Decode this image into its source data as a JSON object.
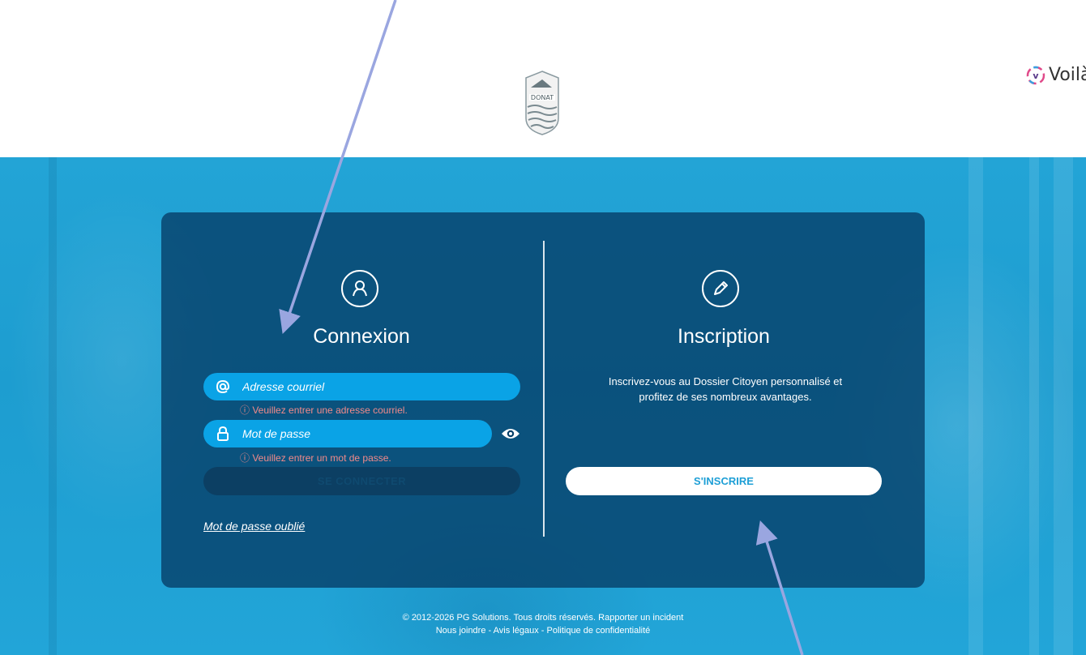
{
  "header": {
    "municipality_logo_alt": "St-Donat",
    "logo_text": "DONAT",
    "brand_name": "Voilà!"
  },
  "login": {
    "title": "Connexion",
    "email_placeholder": "Adresse courriel",
    "email_error": "ⓘ Veuillez entrer une adresse courriel.",
    "password_placeholder": "Mot de passe",
    "password_error": "ⓘ Veuillez entrer un mot de passe.",
    "submit_label": "SE CONNECTER",
    "forgot_label": "Mot de passe oublié"
  },
  "signup": {
    "title": "Inscription",
    "description": "Inscrivez-vous au Dossier Citoyen personnalisé et profitez de ses nombreux avantages.",
    "button_label": "S'INSCRIRE"
  },
  "footer": {
    "copyright": "© 2012-2026 PG Solutions. Tous droits réservés.",
    "report_incident": "Rapporter un incident",
    "contact": "Nous joindre",
    "legal": "Avis légaux",
    "privacy": "Politique de confidentialité",
    "separator": " - "
  },
  "colors": {
    "background": "#1d9dd0",
    "panel": "#063f68",
    "input": "#0aa3e6",
    "error": "#f28a8a",
    "arrow": "#9aa6e0"
  },
  "icons": [
    "user-icon",
    "pencil-icon",
    "at-icon",
    "lock-icon",
    "eye-icon",
    "voila-logo-icon"
  ]
}
